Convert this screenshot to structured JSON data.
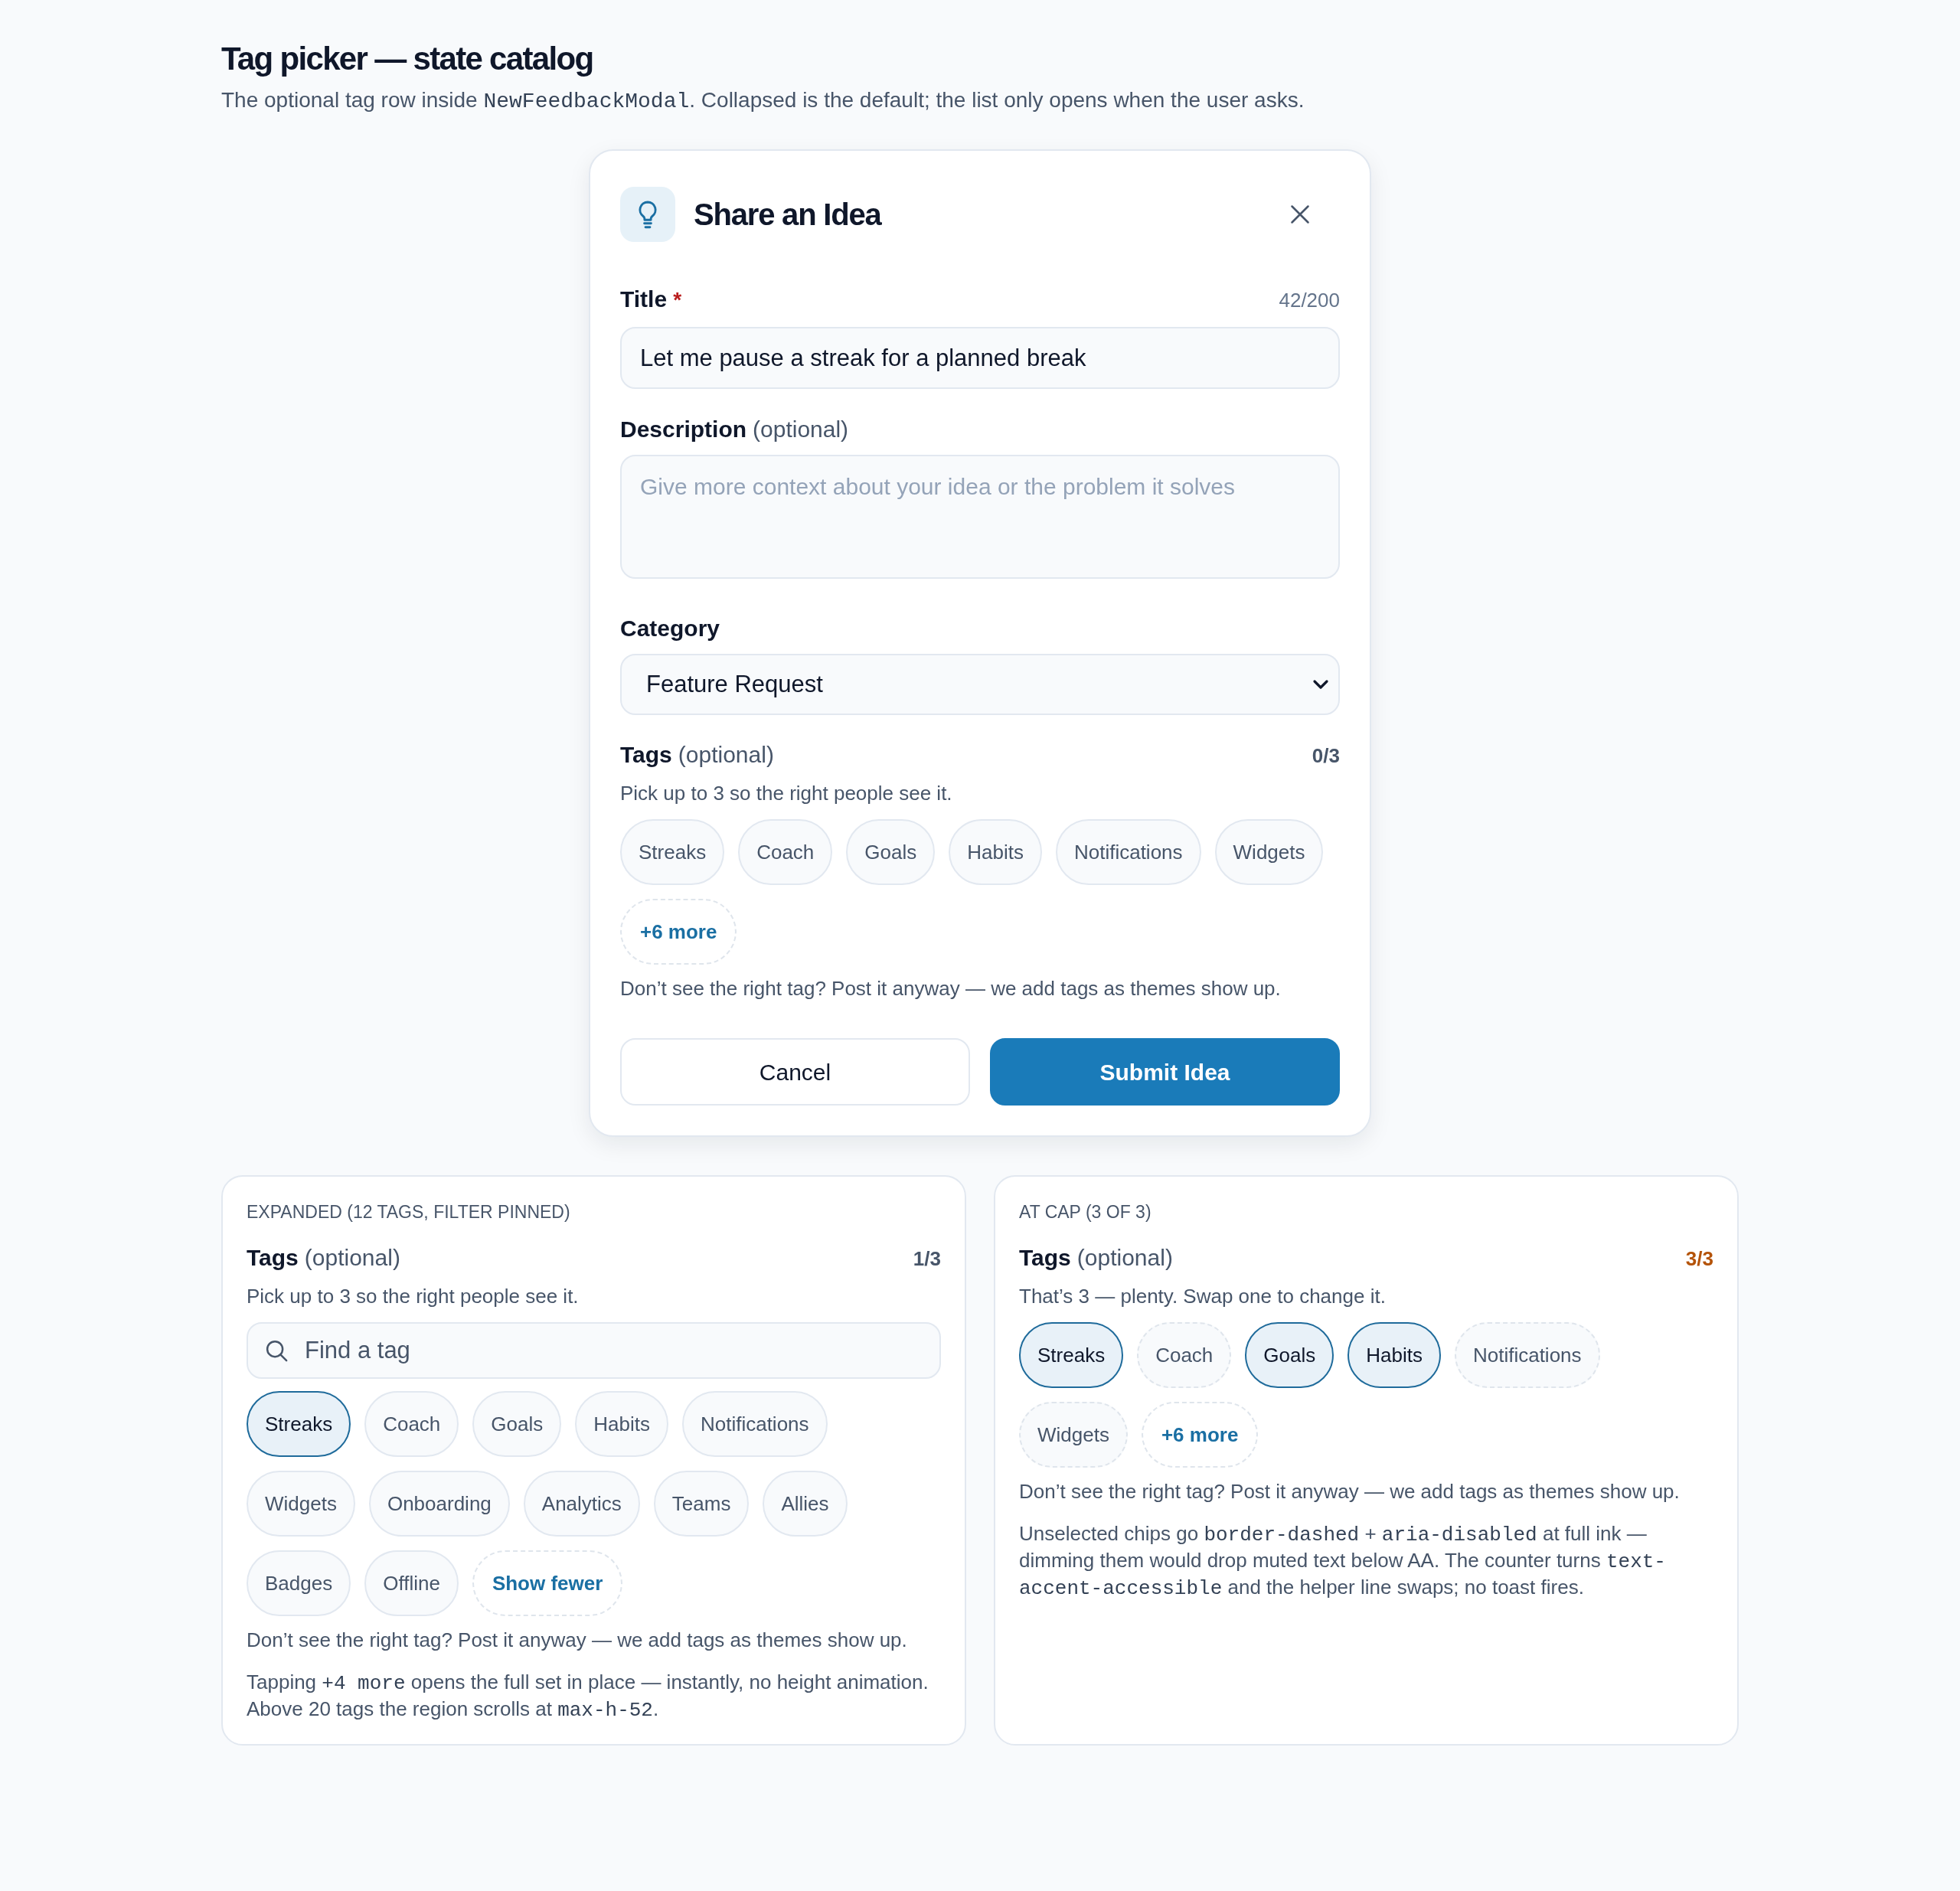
{
  "header": {
    "title": "Tag picker — state catalog",
    "subtitle": [
      {
        "kind": "text",
        "text": "The optional tag row inside "
      },
      {
        "kind": "code",
        "text": "NewFeedbackModal"
      },
      {
        "kind": "text",
        "text": ". Collapsed is the default; the list only opens when the user asks."
      }
    ]
  },
  "modal": {
    "title": "Share an Idea",
    "title_field": {
      "label": "Title",
      "required_mark": "*",
      "counter": "42/200",
      "value": "Let me pause a streak for a planned break"
    },
    "description_field": {
      "label": "Description",
      "hint": "(optional)",
      "placeholder": "Give more context about your idea or the problem it solves"
    },
    "category_field": {
      "label": "Category",
      "value": "Feature Request"
    },
    "tags": {
      "label": "Tags",
      "hint": "(optional)",
      "counter": "0/3",
      "at_cap": false,
      "helper": "Pick up to 3 so the right people see it.",
      "chips": [
        {
          "label": "Streaks",
          "selected": false
        },
        {
          "label": "Coach",
          "selected": false
        },
        {
          "label": "Goals",
          "selected": false
        },
        {
          "label": "Habits",
          "selected": false
        },
        {
          "label": "Notifications",
          "selected": false
        },
        {
          "label": "Widgets",
          "selected": false
        }
      ],
      "more_button": {
        "label": "+6 more"
      },
      "footer": "Don’t see the right tag? Post it anyway — we add tags as themes show up."
    },
    "buttons": [
      {
        "kind": "secondary",
        "label": "Cancel"
      },
      {
        "kind": "primary",
        "label": "Submit Idea"
      }
    ]
  },
  "examples": [
    {
      "caption": "EXPANDED (12 TAGS, FILTER PINNED)",
      "tags": {
        "label": "Tags",
        "hint": "(optional)",
        "counter": "1/3",
        "at_cap": false,
        "helper": "Pick up to 3 so the right people see it.",
        "search": {
          "placeholder": "Find a tag"
        },
        "chips": [
          {
            "label": "Streaks",
            "selected": true
          },
          {
            "label": "Coach",
            "selected": false
          },
          {
            "label": "Goals",
            "selected": false
          },
          {
            "label": "Habits",
            "selected": false
          },
          {
            "label": "Notifications",
            "selected": false
          },
          {
            "label": "Widgets",
            "selected": false
          },
          {
            "label": "Onboarding",
            "selected": false
          },
          {
            "label": "Analytics",
            "selected": false
          },
          {
            "label": "Teams",
            "selected": false
          },
          {
            "label": "Allies",
            "selected": false
          },
          {
            "label": "Badges",
            "selected": false
          },
          {
            "label": "Offline",
            "selected": false
          }
        ],
        "more_button": {
          "label": "Show fewer"
        },
        "footer": "Don’t see the right tag? Post it anyway — we add tags as themes show up."
      },
      "note": [
        {
          "kind": "text",
          "text": "Tapping "
        },
        {
          "kind": "code",
          "text": "+4 more"
        },
        {
          "kind": "text",
          "text": " opens the full set in place — instantly, no height animation. Above 20 tags the region scrolls at "
        },
        {
          "kind": "code",
          "text": "max-h-52"
        },
        {
          "kind": "text",
          "text": "."
        }
      ]
    },
    {
      "caption": "AT CAP (3 OF 3)",
      "tags": {
        "label": "Tags",
        "hint": "(optional)",
        "counter": "3/3",
        "at_cap": true,
        "helper": "That’s 3 — plenty. Swap one to change it.",
        "chips": [
          {
            "label": "Streaks",
            "selected": true,
            "disabled": false
          },
          {
            "label": "Coach",
            "selected": false,
            "disabled": true
          },
          {
            "label": "Goals",
            "selected": true,
            "disabled": false
          },
          {
            "label": "Habits",
            "selected": true,
            "disabled": false
          },
          {
            "label": "Notifications",
            "selected": false,
            "disabled": true
          },
          {
            "label": "Widgets",
            "selected": false,
            "disabled": true
          }
        ],
        "more_button": {
          "label": "+6 more"
        },
        "footer": "Don’t see the right tag? Post it anyway — we add tags as themes show up."
      },
      "note": [
        {
          "kind": "text",
          "text": "Unselected chips go "
        },
        {
          "kind": "code",
          "text": "border-dashed"
        },
        {
          "kind": "text",
          "text": " + "
        },
        {
          "kind": "code",
          "text": "aria-disabled"
        },
        {
          "kind": "text",
          "text": " at full ink — dimming them would drop muted text below AA. The counter turns "
        },
        {
          "kind": "code",
          "text": "text-accent-accessible"
        },
        {
          "kind": "text",
          "text": " and the helper line swaps; no toast fires."
        }
      ]
    }
  ]
}
